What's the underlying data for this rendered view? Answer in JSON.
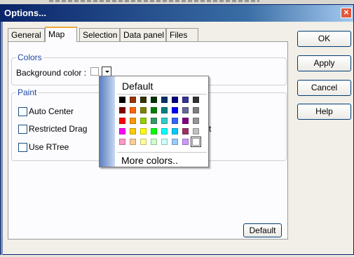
{
  "window": {
    "title": "Options..."
  },
  "tabs": [
    {
      "label": "General"
    },
    {
      "label": "Map"
    },
    {
      "label": "Selection"
    },
    {
      "label": "Data panel"
    },
    {
      "label": "Files"
    }
  ],
  "active_tab": "Map",
  "colors_group": {
    "legend": "Colors",
    "background_label": "Background color :"
  },
  "paint_group": {
    "legend": "Paint",
    "options": [
      {
        "label": "Auto Center",
        "checked": false
      },
      {
        "label": "Restricted Drag",
        "checked": false
      },
      {
        "label": "Use RTree",
        "checked": false
      }
    ],
    "partial_text": "t"
  },
  "buttons": {
    "ok": "OK",
    "apply": "Apply",
    "cancel": "Cancel",
    "help": "Help",
    "default": "Default"
  },
  "color_popup": {
    "default_label": "Default",
    "more_label": "More colors..",
    "rows": [
      [
        "#000000",
        "#993300",
        "#333300",
        "#003300",
        "#003366",
        "#000080",
        "#333399",
        "#333333"
      ],
      [
        "#800000",
        "#ff6600",
        "#808000",
        "#008000",
        "#008080",
        "#0000ff",
        "#666699",
        "#808080"
      ],
      [
        "#ff0000",
        "#ff9900",
        "#99cc00",
        "#339966",
        "#33cccc",
        "#3366ff",
        "#800080",
        "#969696"
      ],
      [
        "#ff00ff",
        "#ffcc00",
        "#ffff00",
        "#00ff00",
        "#00ffff",
        "#00ccff",
        "#993366",
        "#c0c0c0"
      ],
      [
        "#ff99cc",
        "#ffcc99",
        "#ffff99",
        "#ccffcc",
        "#ccffff",
        "#99ccff",
        "#cc99ff",
        "#ffffff"
      ]
    ],
    "selected": "#ffffff"
  }
}
